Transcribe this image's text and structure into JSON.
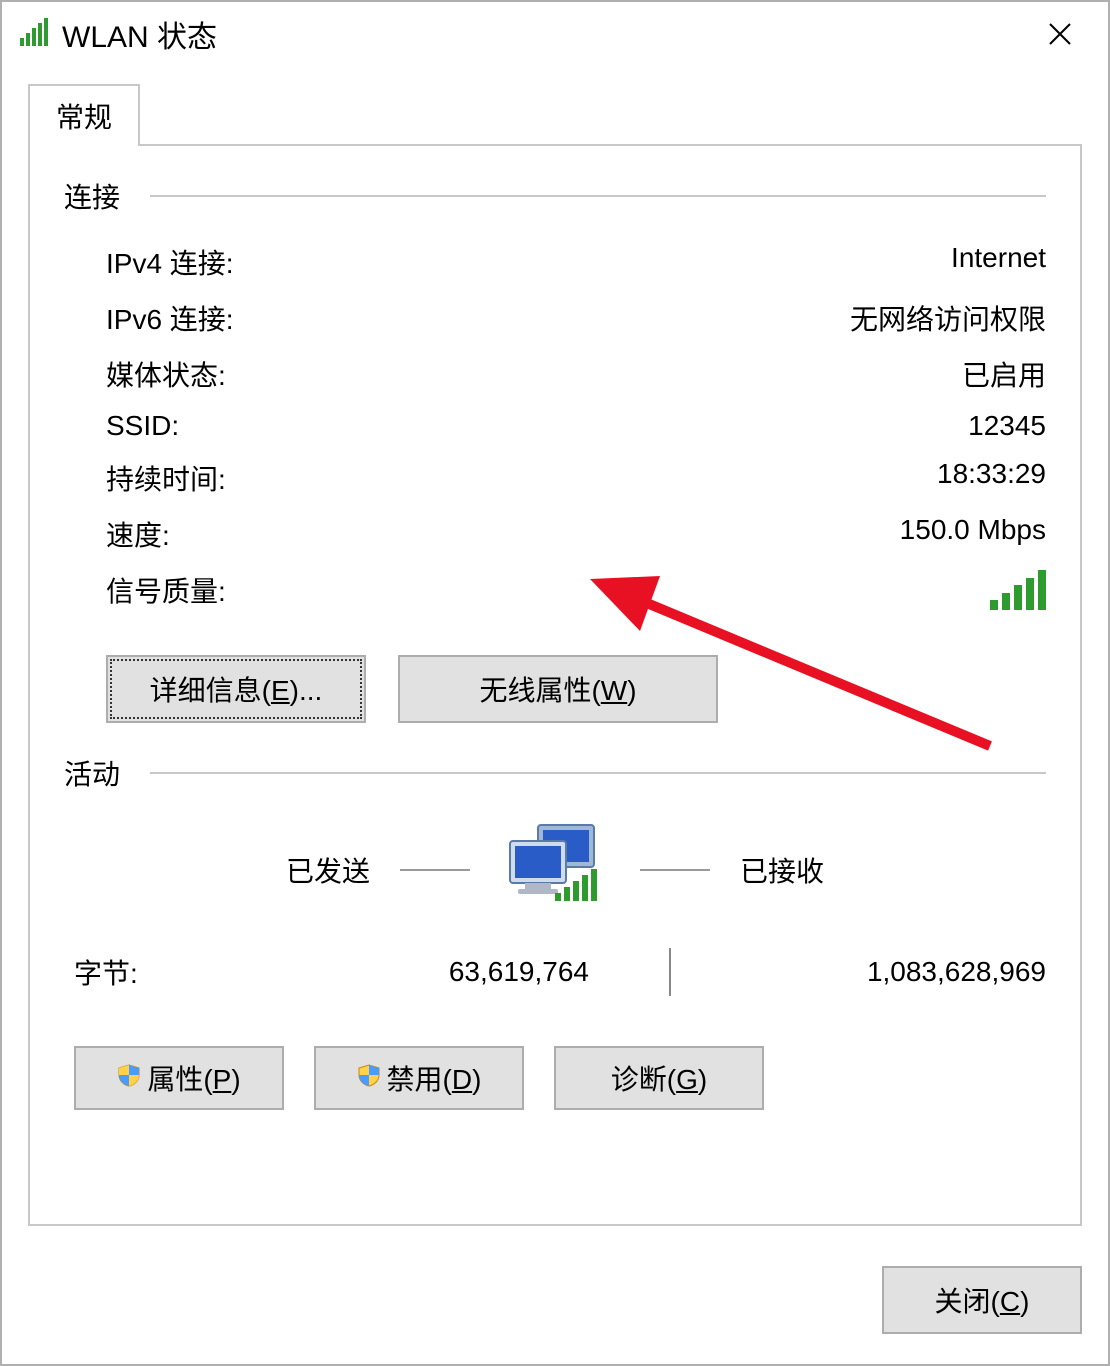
{
  "window": {
    "title": "WLAN 状态",
    "tab": "常规",
    "close_label": "关闭(C)",
    "accel_close": "C"
  },
  "connection": {
    "section": "连接",
    "ipv4_label": "IPv4 连接:",
    "ipv4_value": "Internet",
    "ipv6_label": "IPv6 连接:",
    "ipv6_value": "无网络访问权限",
    "media_label": "媒体状态:",
    "media_value": "已启用",
    "ssid_label": "SSID:",
    "ssid_value": "12345",
    "duration_label": "持续时间:",
    "duration_value": "18:33:29",
    "speed_label": "速度:",
    "speed_value": "150.0 Mbps",
    "signal_label": "信号质量:"
  },
  "buttons": {
    "details": "详细信息(E)...",
    "accel_details": "E",
    "wireless": "无线属性(W)",
    "accel_wireless": "W",
    "properties": "属性(P)",
    "accel_properties": "P",
    "disable": "禁用(D)",
    "accel_disable": "D",
    "diagnose": "诊断(G)",
    "accel_diagnose": "G"
  },
  "activity": {
    "section": "活动",
    "sent_label": "已发送",
    "recv_label": "已接收",
    "bytes_label": "字节:",
    "bytes_sent": "63,619,764",
    "bytes_recv": "1,083,628,969"
  }
}
